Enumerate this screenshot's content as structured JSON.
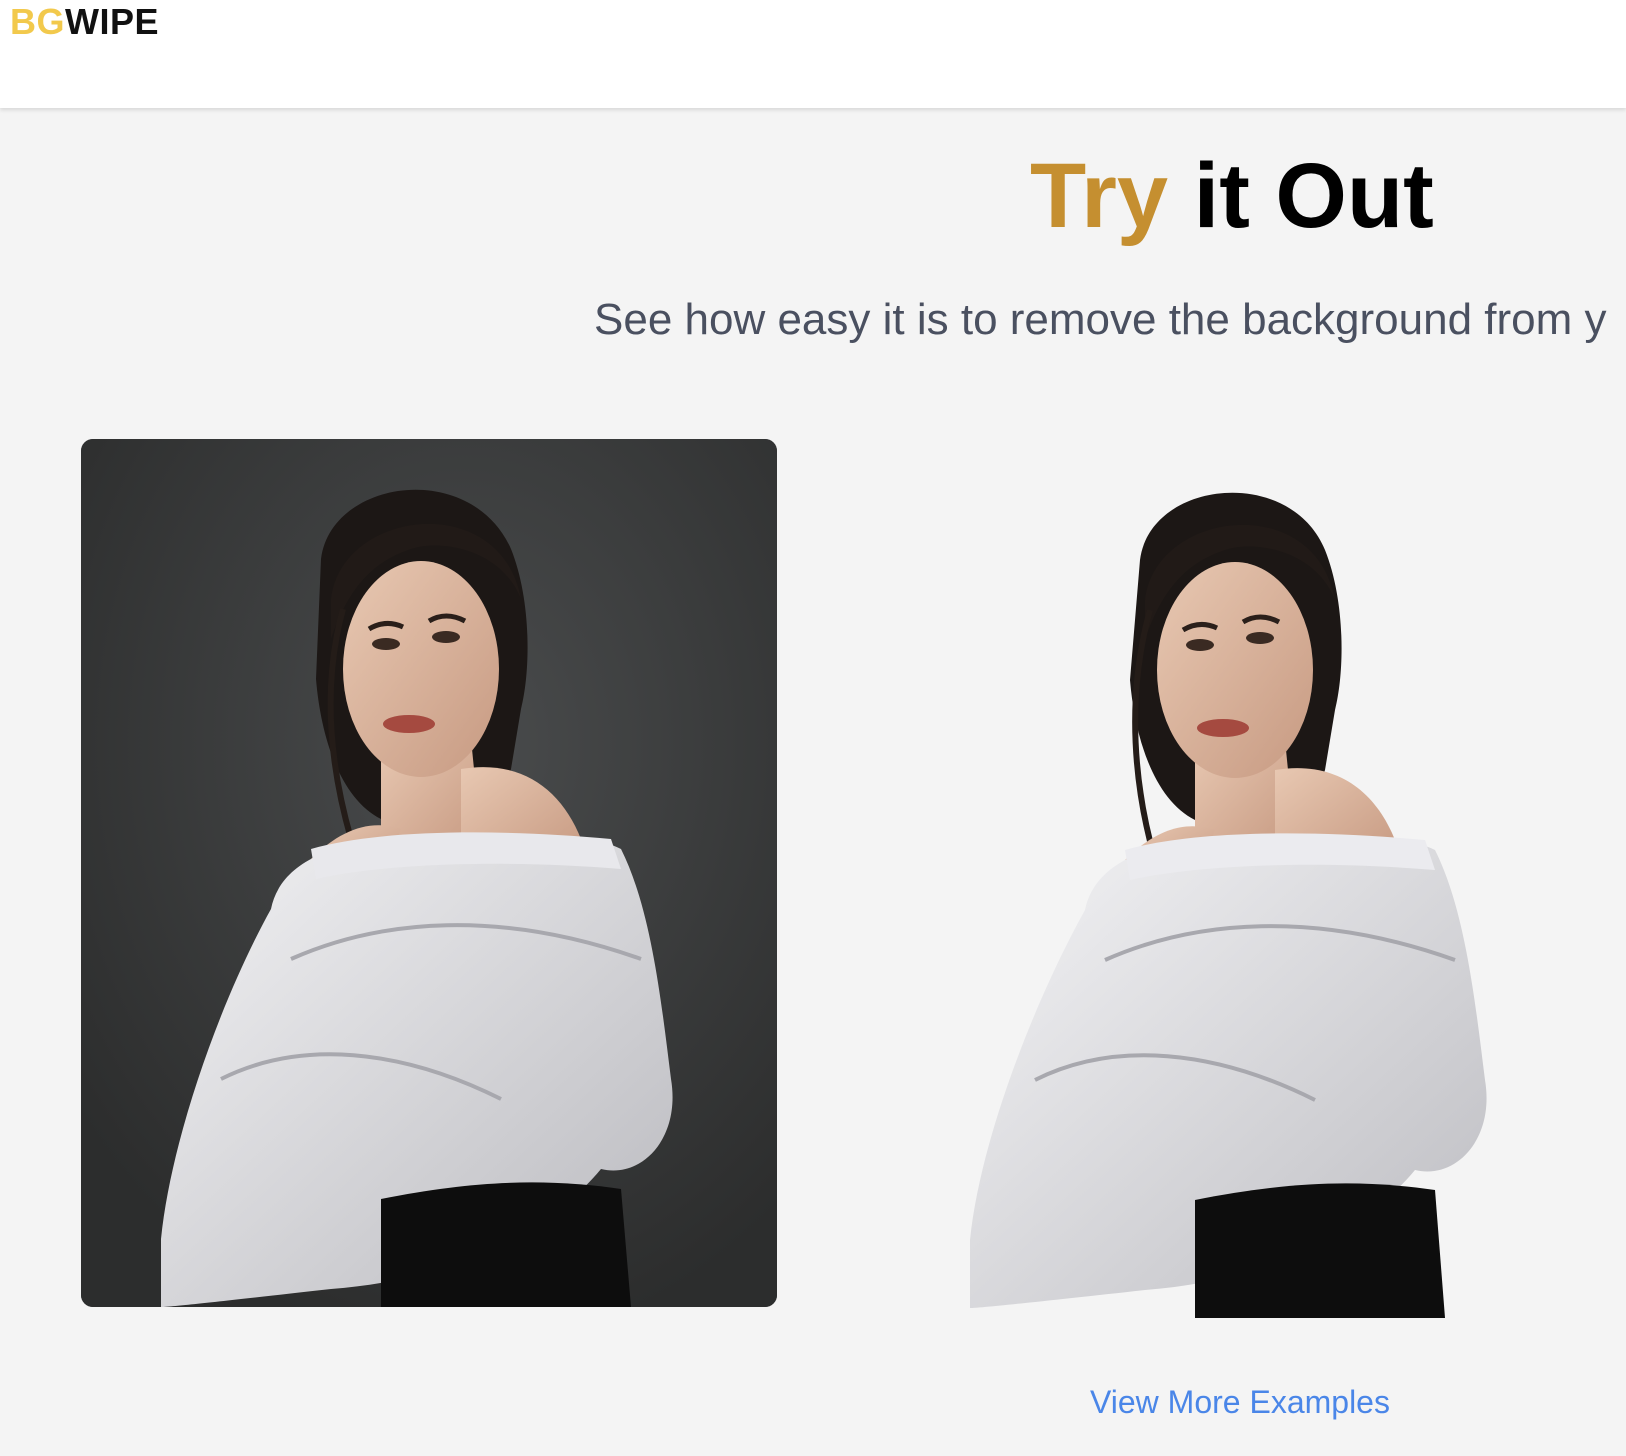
{
  "header": {
    "logo_part1": "BG",
    "logo_part2": "WIPE"
  },
  "hero": {
    "title_accent": "Try",
    "title_rest": " it Out",
    "subtitle": "See how easy it is to remove the background from y"
  },
  "examples": {
    "original_image": "portrait-original",
    "result_image": "portrait-background-removed",
    "view_more_label": "View More Examples"
  },
  "colors": {
    "logo_accent": "#f2c94c",
    "title_accent": "#c58f30",
    "link": "#4a86e8",
    "page_background": "#f4f4f4"
  }
}
